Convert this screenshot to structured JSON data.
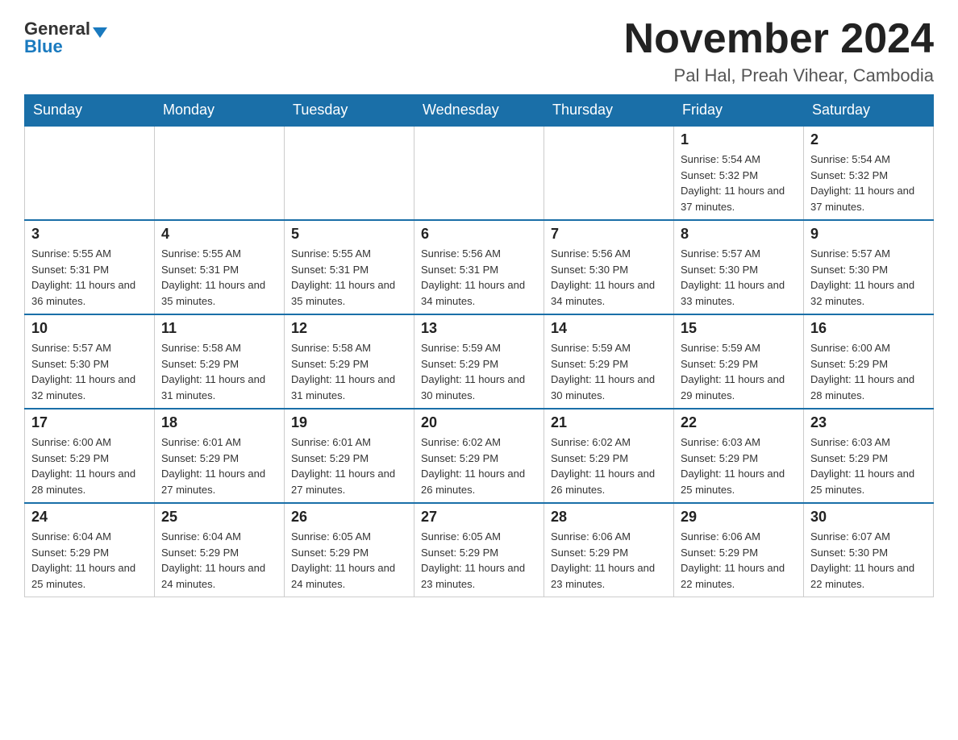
{
  "logo": {
    "general": "General",
    "blue": "Blue"
  },
  "title": {
    "month_year": "November 2024",
    "location": "Pal Hal, Preah Vihear, Cambodia"
  },
  "weekdays": [
    "Sunday",
    "Monday",
    "Tuesday",
    "Wednesday",
    "Thursday",
    "Friday",
    "Saturday"
  ],
  "weeks": [
    [
      {
        "day": "",
        "info": ""
      },
      {
        "day": "",
        "info": ""
      },
      {
        "day": "",
        "info": ""
      },
      {
        "day": "",
        "info": ""
      },
      {
        "day": "",
        "info": ""
      },
      {
        "day": "1",
        "info": "Sunrise: 5:54 AM\nSunset: 5:32 PM\nDaylight: 11 hours and 37 minutes."
      },
      {
        "day": "2",
        "info": "Sunrise: 5:54 AM\nSunset: 5:32 PM\nDaylight: 11 hours and 37 minutes."
      }
    ],
    [
      {
        "day": "3",
        "info": "Sunrise: 5:55 AM\nSunset: 5:31 PM\nDaylight: 11 hours and 36 minutes."
      },
      {
        "day": "4",
        "info": "Sunrise: 5:55 AM\nSunset: 5:31 PM\nDaylight: 11 hours and 35 minutes."
      },
      {
        "day": "5",
        "info": "Sunrise: 5:55 AM\nSunset: 5:31 PM\nDaylight: 11 hours and 35 minutes."
      },
      {
        "day": "6",
        "info": "Sunrise: 5:56 AM\nSunset: 5:31 PM\nDaylight: 11 hours and 34 minutes."
      },
      {
        "day": "7",
        "info": "Sunrise: 5:56 AM\nSunset: 5:30 PM\nDaylight: 11 hours and 34 minutes."
      },
      {
        "day": "8",
        "info": "Sunrise: 5:57 AM\nSunset: 5:30 PM\nDaylight: 11 hours and 33 minutes."
      },
      {
        "day": "9",
        "info": "Sunrise: 5:57 AM\nSunset: 5:30 PM\nDaylight: 11 hours and 32 minutes."
      }
    ],
    [
      {
        "day": "10",
        "info": "Sunrise: 5:57 AM\nSunset: 5:30 PM\nDaylight: 11 hours and 32 minutes."
      },
      {
        "day": "11",
        "info": "Sunrise: 5:58 AM\nSunset: 5:29 PM\nDaylight: 11 hours and 31 minutes."
      },
      {
        "day": "12",
        "info": "Sunrise: 5:58 AM\nSunset: 5:29 PM\nDaylight: 11 hours and 31 minutes."
      },
      {
        "day": "13",
        "info": "Sunrise: 5:59 AM\nSunset: 5:29 PM\nDaylight: 11 hours and 30 minutes."
      },
      {
        "day": "14",
        "info": "Sunrise: 5:59 AM\nSunset: 5:29 PM\nDaylight: 11 hours and 30 minutes."
      },
      {
        "day": "15",
        "info": "Sunrise: 5:59 AM\nSunset: 5:29 PM\nDaylight: 11 hours and 29 minutes."
      },
      {
        "day": "16",
        "info": "Sunrise: 6:00 AM\nSunset: 5:29 PM\nDaylight: 11 hours and 28 minutes."
      }
    ],
    [
      {
        "day": "17",
        "info": "Sunrise: 6:00 AM\nSunset: 5:29 PM\nDaylight: 11 hours and 28 minutes."
      },
      {
        "day": "18",
        "info": "Sunrise: 6:01 AM\nSunset: 5:29 PM\nDaylight: 11 hours and 27 minutes."
      },
      {
        "day": "19",
        "info": "Sunrise: 6:01 AM\nSunset: 5:29 PM\nDaylight: 11 hours and 27 minutes."
      },
      {
        "day": "20",
        "info": "Sunrise: 6:02 AM\nSunset: 5:29 PM\nDaylight: 11 hours and 26 minutes."
      },
      {
        "day": "21",
        "info": "Sunrise: 6:02 AM\nSunset: 5:29 PM\nDaylight: 11 hours and 26 minutes."
      },
      {
        "day": "22",
        "info": "Sunrise: 6:03 AM\nSunset: 5:29 PM\nDaylight: 11 hours and 25 minutes."
      },
      {
        "day": "23",
        "info": "Sunrise: 6:03 AM\nSunset: 5:29 PM\nDaylight: 11 hours and 25 minutes."
      }
    ],
    [
      {
        "day": "24",
        "info": "Sunrise: 6:04 AM\nSunset: 5:29 PM\nDaylight: 11 hours and 25 minutes."
      },
      {
        "day": "25",
        "info": "Sunrise: 6:04 AM\nSunset: 5:29 PM\nDaylight: 11 hours and 24 minutes."
      },
      {
        "day": "26",
        "info": "Sunrise: 6:05 AM\nSunset: 5:29 PM\nDaylight: 11 hours and 24 minutes."
      },
      {
        "day": "27",
        "info": "Sunrise: 6:05 AM\nSunset: 5:29 PM\nDaylight: 11 hours and 23 minutes."
      },
      {
        "day": "28",
        "info": "Sunrise: 6:06 AM\nSunset: 5:29 PM\nDaylight: 11 hours and 23 minutes."
      },
      {
        "day": "29",
        "info": "Sunrise: 6:06 AM\nSunset: 5:29 PM\nDaylight: 11 hours and 22 minutes."
      },
      {
        "day": "30",
        "info": "Sunrise: 6:07 AM\nSunset: 5:30 PM\nDaylight: 11 hours and 22 minutes."
      }
    ]
  ]
}
